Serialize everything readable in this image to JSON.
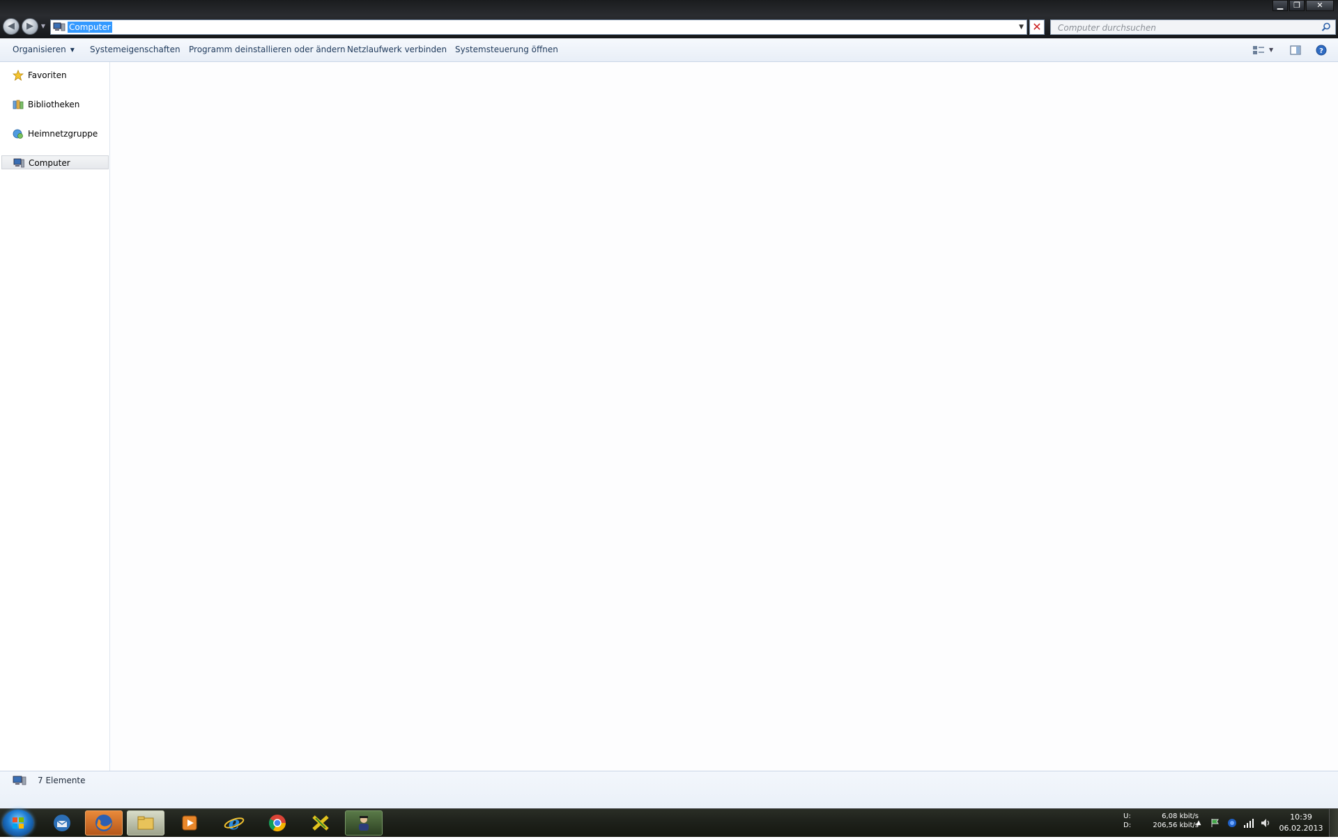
{
  "window": {
    "address_text": "Computer",
    "search_placeholder": "Computer durchsuchen"
  },
  "toolbar": {
    "items": [
      {
        "label": "Organisieren"
      },
      {
        "label": "Systemeigenschaften"
      },
      {
        "label": "Programm deinstallieren oder ändern"
      },
      {
        "label": "Netzlaufwerk verbinden"
      },
      {
        "label": "Systemsteuerung öffnen"
      }
    ]
  },
  "sidebar": {
    "items": [
      {
        "label": "Favoriten",
        "icon": "star-icon"
      },
      {
        "label": "Bibliotheken",
        "icon": "library-icon"
      },
      {
        "label": "Heimnetzgruppe",
        "icon": "homegroup-icon"
      },
      {
        "label": "Computer",
        "icon": "computer-icon",
        "selected": true
      }
    ]
  },
  "status": {
    "count_text": "7 Elemente"
  },
  "taskbar": {
    "apps": [
      {
        "name": "thunderbird-icon"
      },
      {
        "name": "firefox-icon"
      },
      {
        "name": "explorer-icon"
      },
      {
        "name": "media-player-icon"
      },
      {
        "name": "internet-explorer-icon"
      },
      {
        "name": "chrome-icon"
      },
      {
        "name": "app-icon"
      },
      {
        "name": "agent-app-icon"
      }
    ],
    "tray": {
      "upload_label": "U:",
      "upload_value": "6,08 kbit/s",
      "download_label": "D:",
      "download_value": "206,56 kbit/s",
      "time": "10:39",
      "date": "06.02.2013"
    }
  },
  "colors": {
    "accent": "#3399ff",
    "toolbar_text": "#1e395b",
    "close_red": "#cc1f1f"
  }
}
